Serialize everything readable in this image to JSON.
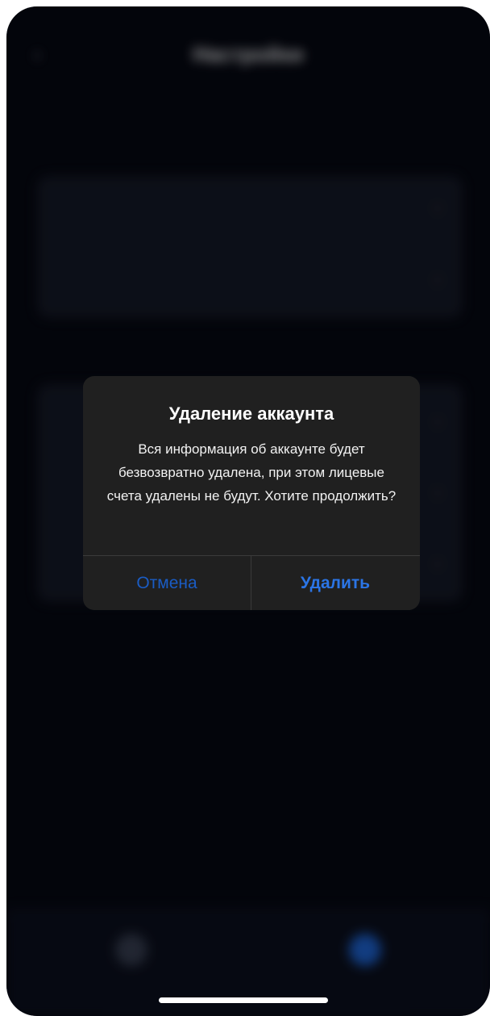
{
  "background": {
    "nav_title": "Настройки",
    "nav_subtitle": "",
    "account_section": {
      "label": "",
      "rows": [
        {
          "label": "",
          "value": ""
        },
        {
          "label": "",
          "value": ""
        }
      ]
    },
    "app_section": {
      "label": "",
      "rows": [
        {
          "label": ""
        },
        {
          "label": ""
        },
        {
          "label": ""
        }
      ]
    },
    "delete_account_link": "",
    "tabs": [
      {
        "label": ""
      },
      {
        "label": ""
      }
    ]
  },
  "dialog": {
    "title": "Удаление аккаунта",
    "message": "Вся информация об аккаунте будет безвозвратно удалена, при этом лицевые счета удалены не будут. Хотите продолжить?",
    "cancel_label": "Отмена",
    "confirm_label": "Удалить"
  },
  "colors": {
    "dialog_bg": "#202020",
    "accent": "#2b75e6",
    "danger": "#b5121e",
    "screen_bg": "#05070f"
  }
}
